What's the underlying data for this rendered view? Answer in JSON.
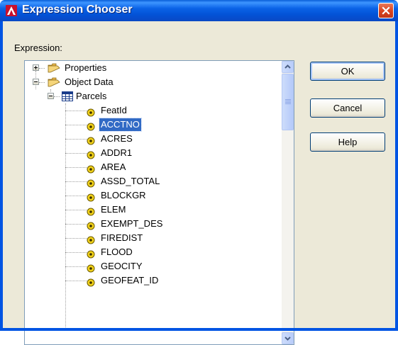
{
  "window": {
    "title": "Expression Chooser",
    "app_icon": "autocad-icon",
    "close_icon": "close-icon"
  },
  "expression_label": "Expression:",
  "tree": {
    "properties": {
      "label": "Properties",
      "expanded": false
    },
    "object_data": {
      "label": "Object Data",
      "expanded": true
    },
    "parcels": {
      "label": "Parcels",
      "expanded": true
    },
    "fields": [
      {
        "label": "FeatId"
      },
      {
        "label": "ACCTNO",
        "selected": true
      },
      {
        "label": "ACRES"
      },
      {
        "label": "ADDR1"
      },
      {
        "label": "AREA"
      },
      {
        "label": "ASSD_TOTAL"
      },
      {
        "label": "BLOCKGR"
      },
      {
        "label": "ELEM"
      },
      {
        "label": "EXEMPT_DES"
      },
      {
        "label": "FIREDIST"
      },
      {
        "label": "FLOOD"
      },
      {
        "label": "GEOCITY"
      },
      {
        "label": "GEOFEAT_ID"
      }
    ]
  },
  "buttons": {
    "ok": "OK",
    "cancel": "Cancel",
    "help": "Help"
  },
  "colors": {
    "titlebar": "#0054e3",
    "selection": "#316ac5",
    "dialog_bg": "#ece9d8",
    "close_button": "#d8421e"
  }
}
